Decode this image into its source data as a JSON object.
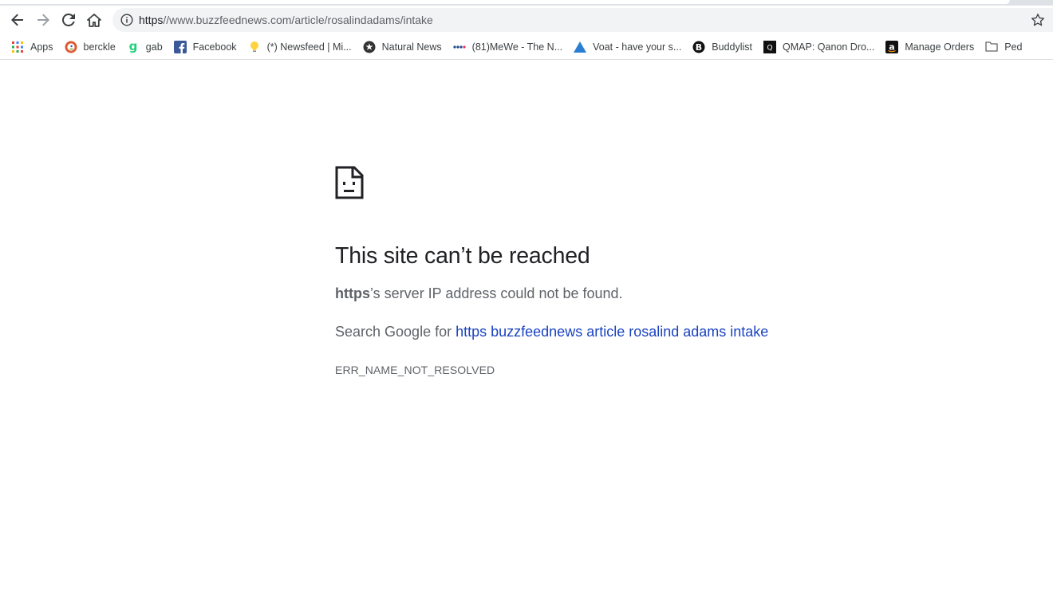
{
  "browser": {
    "url_scheme": "https",
    "url_rest": "//www.buzzfeednews.com/article/rosalindadams/intake",
    "icons": {
      "back": "back-arrow-icon",
      "forward": "forward-arrow-icon",
      "reload": "reload-icon",
      "home": "home-icon",
      "info": "info-icon",
      "bookmark_star": "star-icon"
    }
  },
  "bookmarks": [
    {
      "label": "Apps",
      "icon": "apps-grid-icon"
    },
    {
      "label": "berckle",
      "icon": "duckduckgo-icon"
    },
    {
      "label": "gab",
      "icon": "gab-icon"
    },
    {
      "label": "Facebook",
      "icon": "facebook-icon"
    },
    {
      "label": "(*) Newsfeed | Mi...",
      "icon": "lightbulb-icon"
    },
    {
      "label": "Natural News",
      "icon": "natural-news-icon"
    },
    {
      "label": "(81)MeWe - The N...",
      "icon": "mewe-icon"
    },
    {
      "label": "Voat - have your s...",
      "icon": "voat-icon"
    },
    {
      "label": "Buddylist",
      "icon": "buddylist-icon"
    },
    {
      "label": "QMAP: Qanon Dro...",
      "icon": "qmap-icon"
    },
    {
      "label": "Manage Orders",
      "icon": "amazon-icon"
    },
    {
      "label": "Ped",
      "icon": "folder-icon"
    }
  ],
  "error_page": {
    "icon": "sad-page-icon",
    "title": "This site can’t be reached",
    "host": "https",
    "desc_suffix": "’s server IP address could not be found.",
    "search_prefix": "Search Google for ",
    "search_link": "https buzzfeednews article rosalind adams intake",
    "error_code": "ERR_NAME_NOT_RESOLVED"
  },
  "colors": {
    "link": "#1a43c1",
    "text_secondary": "#5f6368",
    "omnibox_bg": "#f1f3f4"
  }
}
